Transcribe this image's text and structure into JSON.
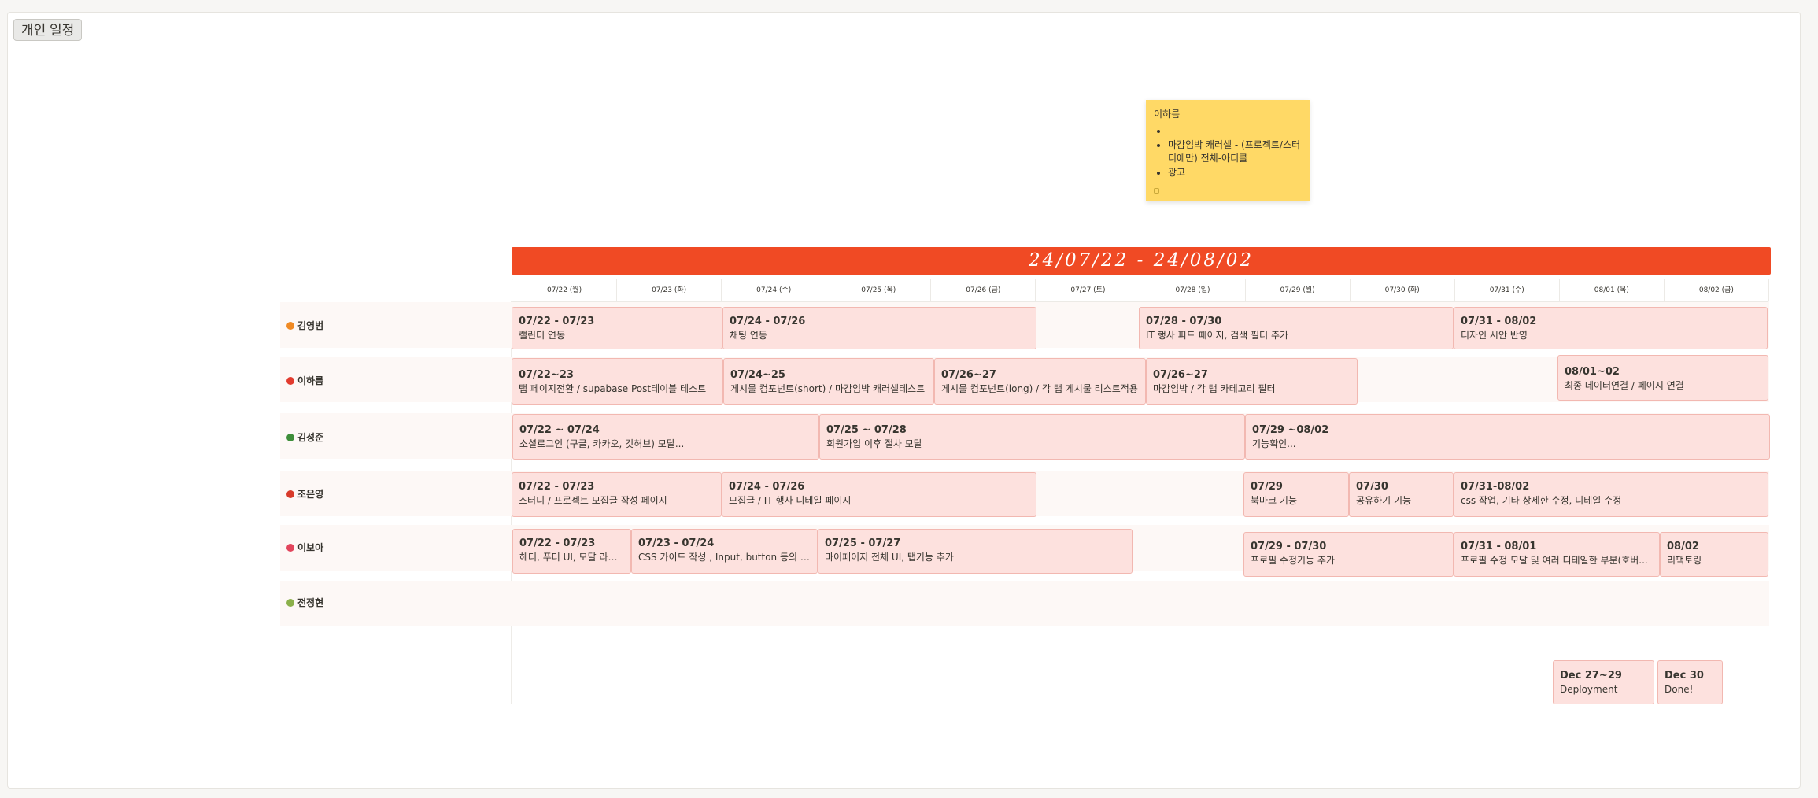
{
  "page": {
    "title": "개인 일정"
  },
  "sticky_note": {
    "name": "이하름",
    "items": [
      "",
      "마감임박 캐러셀 - (프로젝트/스터디에만) 전체-아티클",
      "광고"
    ]
  },
  "banner": {
    "range": "24/07/22 - 24/08/02"
  },
  "dates": [
    "07/22 (월)",
    "07/23 (화)",
    "07/24 (수)",
    "07/25 (목)",
    "07/26 (금)",
    "07/27 (토)",
    "07/28 (일)",
    "07/29 (월)",
    "07/30 (화)",
    "07/31 (수)",
    "08/01 (목)",
    "08/02 (금)"
  ],
  "members": [
    {
      "name": "김영범",
      "emoji_color": "#f08a24",
      "tasks": [
        {
          "date": "07/22 - 07/23",
          "text": "캘린더 연동"
        },
        {
          "date": "07/24 - 07/26",
          "text": "채팅 연동"
        },
        {
          "date": "07/28 - 07/30",
          "text": "IT 행사 피드 페이지, 검색 필터 추가"
        },
        {
          "date": "07/31 - 08/02",
          "text": "디자인 시안 반영"
        }
      ]
    },
    {
      "name": "이하름",
      "emoji_color": "#e23b2e",
      "tasks": [
        {
          "date": "07/22~23",
          "text": "탭 페이지전환 / supabase Post테이블 테스트"
        },
        {
          "date": "07/24~25",
          "text": "게시물 컴포넌트(short) / 마감임박 캐러셀테스트"
        },
        {
          "date": "07/26~27",
          "text": "게시물 컴포넌트(long) / 각 탭 게시물 리스트적용"
        },
        {
          "date": "07/26~27",
          "text": "마감임박 / 각 탭 카테고리 필터"
        },
        {
          "date": "08/01~02",
          "text": "최종 데이터연결 / 페이지 연결"
        }
      ]
    },
    {
      "name": "김성준",
      "emoji_color": "#3e8e3a",
      "tasks": [
        {
          "date": "07/22 ~ 07/24",
          "text": "소셜로그인 (구글, 카카오, 깃허브) 모달..."
        },
        {
          "date": "07/25 ~ 07/28",
          "text": "회원가입 이후 절차 모달"
        },
        {
          "date": "07/29 ~08/02",
          "text": " 기능확인..."
        }
      ]
    },
    {
      "name": "조은영",
      "emoji_color": "#d83a2a",
      "tasks": [
        {
          "date": "07/22 - 07/23",
          "text": "스터디 / 프로젝트 모집글 작성 페이지"
        },
        {
          "date": "07/24 - 07/26",
          "text": "모집글 / IT 행사 디테일 페이지"
        },
        {
          "date": "07/29",
          "text": "북마크 기능"
        },
        {
          "date": "07/30",
          "text": "공유하기 기능"
        },
        {
          "date": "07/31-08/02",
          "text": "css 작업, 기타 상세한 수정, 디테일 수정"
        }
      ]
    },
    {
      "name": "이보아",
      "emoji_color": "#e2455c",
      "tasks": [
        {
          "date": "07/22 - 07/23",
          "text": "헤더, 푸터 UI, 모달 라이..."
        },
        {
          "date": "07/23 - 07/24",
          "text": "CSS 가이드 작성 , Input, button 등의 공..."
        },
        {
          "date": "07/25 - 07/27",
          "text": "마이페이지 전체 UI, 탭기능 추가"
        },
        {
          "date": "07/29 - 07/30",
          "text": "프로필 수정기능 추가"
        },
        {
          "date": "07/31 - 08/01",
          "text": "프로필 수정 모달 및 여러 디테일한 부분(호버..."
        },
        {
          "date": "08/02",
          "text": "리팩토링"
        }
      ]
    },
    {
      "name": "전정현",
      "emoji_color": "#8bb04a",
      "tasks": []
    }
  ],
  "extra_tasks": [
    {
      "date": "Dec 27~29",
      "text": "Deployment"
    },
    {
      "date": "Dec 30",
      "text": "Done!"
    }
  ]
}
